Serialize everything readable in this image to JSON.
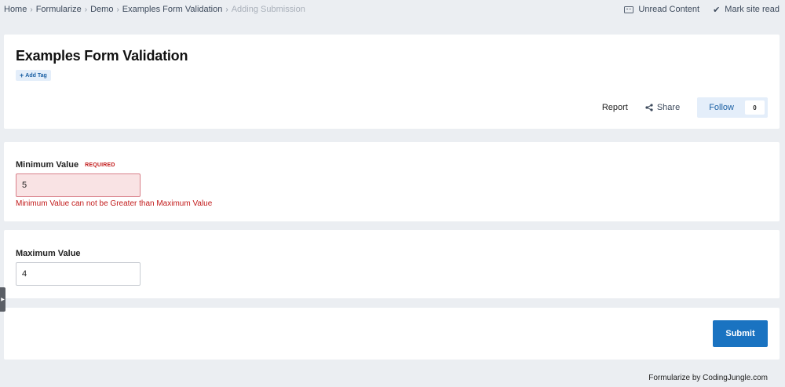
{
  "breadcrumb": {
    "items": [
      "Home",
      "Formularize",
      "Demo",
      "Examples Form Validation"
    ],
    "current": "Adding Submission",
    "separator": "›"
  },
  "top_actions": {
    "unread": "Unread Content",
    "mark_read": "Mark site read"
  },
  "header": {
    "title": "Examples Form Validation",
    "add_tag": "Add Tag",
    "report": "Report",
    "share": "Share",
    "follow": "Follow",
    "follow_count": "0"
  },
  "fields": {
    "minimum": {
      "label": "Minimum Value",
      "required": "REQUIRED",
      "value": "5",
      "error": "Minimum Value can not be Greater than Maximum Value"
    },
    "maximum": {
      "label": "Maximum Value",
      "value": "4"
    }
  },
  "submit": {
    "label": "Submit"
  },
  "footer": {
    "credit": "Formularize by CodingJungle.com"
  },
  "colors": {
    "page_bg": "#ebeef2",
    "accent": "#1a73c1",
    "error": "#c21a1a",
    "error_bg": "#f9e3e4"
  },
  "icons": {
    "unread": "keyboard-icon",
    "mark_read": "check-icon",
    "share": "share-icon",
    "add_tag": "plus-icon",
    "side_handle": "chevron-right-icon"
  }
}
